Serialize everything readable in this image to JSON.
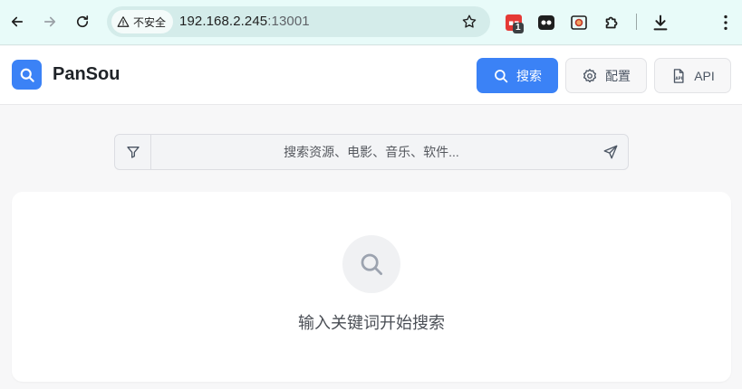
{
  "browser": {
    "security_label": "不安全",
    "url_host": "192.168.2.245",
    "url_port": ":13001",
    "extension_badge": "1"
  },
  "app": {
    "brand": "PanSou",
    "buttons": {
      "search": "搜索",
      "config": "配置",
      "api": "API"
    }
  },
  "search": {
    "placeholder": "搜索资源、电影、音乐、软件..."
  },
  "empty_state": {
    "message": "输入关键词开始搜索"
  },
  "colors": {
    "accent": "#3b82f6",
    "browser_bar": "#e8fbf9"
  }
}
